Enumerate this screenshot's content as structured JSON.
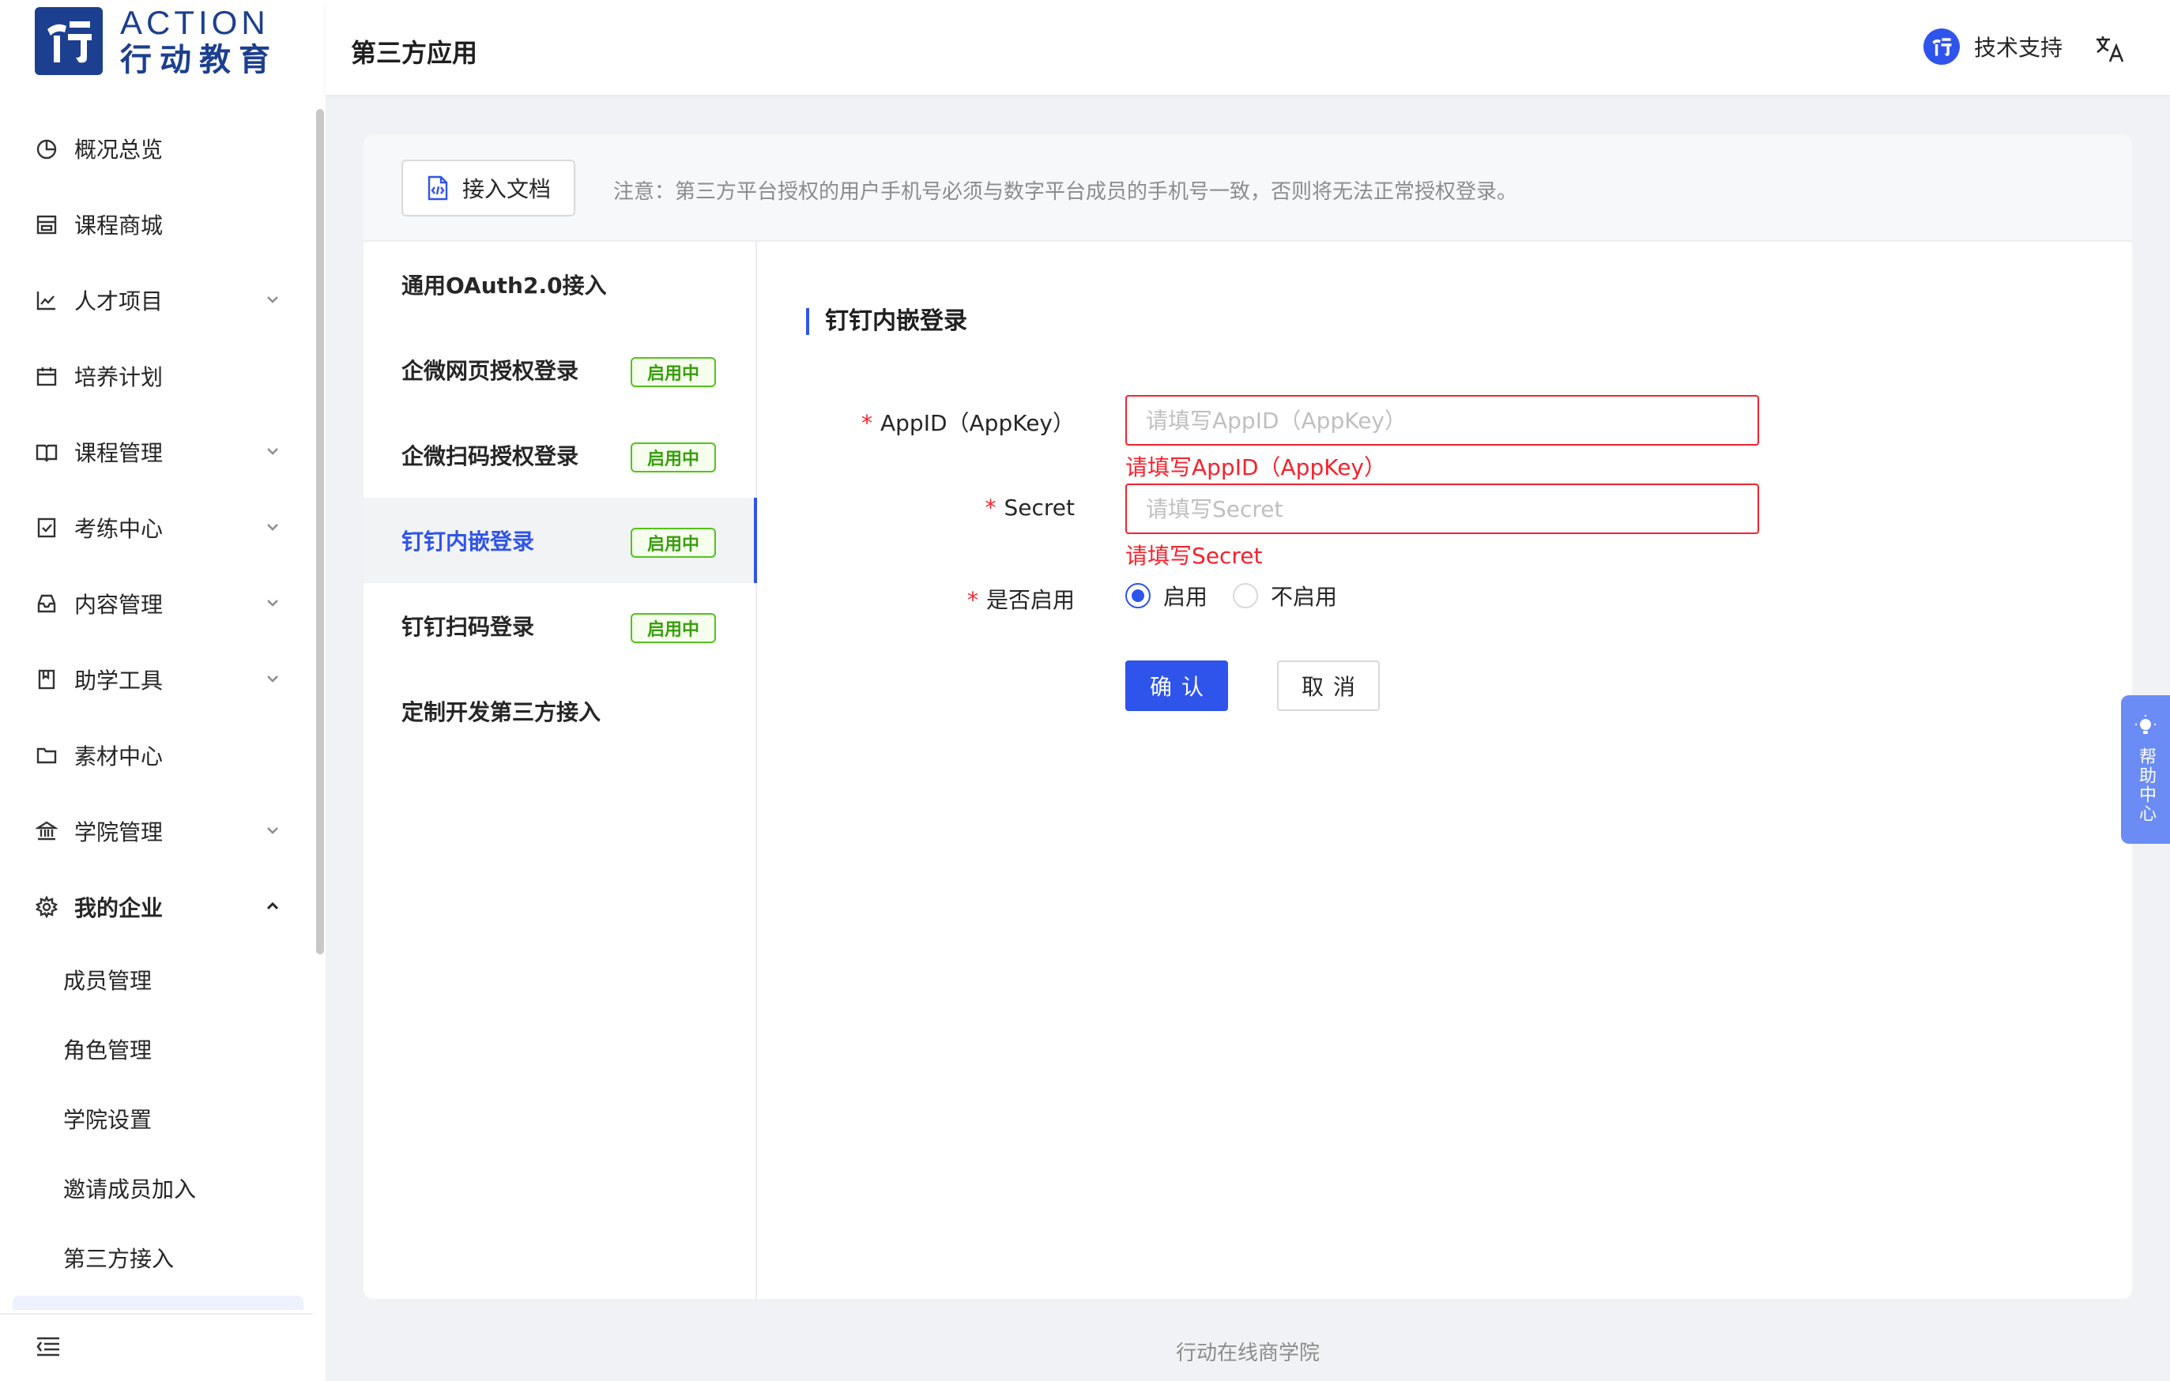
{
  "brand": {
    "name_en": "ACTION",
    "name_cn": "行动教育"
  },
  "header": {
    "title": "第三方应用",
    "support_label": "技术支持"
  },
  "sidebar": {
    "items": [
      {
        "label": "概况总览",
        "icon": "pie-chart-icon",
        "expandable": false
      },
      {
        "label": "课程商城",
        "icon": "shop-icon",
        "expandable": false
      },
      {
        "label": "人才项目",
        "icon": "line-chart-icon",
        "expandable": true
      },
      {
        "label": "培养计划",
        "icon": "calendar-icon",
        "expandable": false
      },
      {
        "label": "课程管理",
        "icon": "book-icon",
        "expandable": true
      },
      {
        "label": "考练中心",
        "icon": "exam-icon",
        "expandable": true
      },
      {
        "label": "内容管理",
        "icon": "inbox-icon",
        "expandable": true
      },
      {
        "label": "助学工具",
        "icon": "bookmark-icon",
        "expandable": true
      },
      {
        "label": "素材中心",
        "icon": "folder-icon",
        "expandable": false
      },
      {
        "label": "学院管理",
        "icon": "bank-icon",
        "expandable": true
      },
      {
        "label": "我的企业",
        "icon": "gear-icon",
        "expandable": true,
        "expanded": true
      }
    ],
    "sub_items": [
      "成员管理",
      "角色管理",
      "学院设置",
      "邀请成员加入",
      "第三方接入"
    ]
  },
  "notice": {
    "doc_button": "接入文档",
    "text": "注意：第三方平台授权的用户手机号必须与数字平台成员的手机号一致，否则将无法正常授权登录。"
  },
  "integrations": [
    {
      "label": "通用OAuth2.0接入",
      "badge": ""
    },
    {
      "label": "企微网页授权登录",
      "badge": "启用中"
    },
    {
      "label": "企微扫码授权登录",
      "badge": "启用中"
    },
    {
      "label": "钉钉内嵌登录",
      "badge": "启用中",
      "selected": true
    },
    {
      "label": "钉钉扫码登录",
      "badge": "启用中"
    },
    {
      "label": "定制开发第三方接入",
      "badge": ""
    }
  ],
  "form": {
    "title": "钉钉内嵌登录",
    "required_mark": "*",
    "appid": {
      "label": "AppID（AppKey）",
      "value": "",
      "placeholder": "请填写AppID（AppKey）",
      "error": "请填写AppID（AppKey）"
    },
    "secret": {
      "label": "Secret",
      "value": "",
      "placeholder": "请填写Secret",
      "error": "请填写Secret"
    },
    "enable": {
      "label": "是否启用",
      "options": [
        "启用",
        "不启用"
      ],
      "selected": "启用"
    },
    "confirm_label": "确认",
    "cancel_label": "取消"
  },
  "help_tab": {
    "label": "帮助中心"
  },
  "footer": {
    "text": "行动在线商学院"
  },
  "colors": {
    "primary": "#2f54eb",
    "brand": "#1c3f8f",
    "error": "#f5222d",
    "success": "#52c41a",
    "help_tab": "#6b8cf5"
  }
}
